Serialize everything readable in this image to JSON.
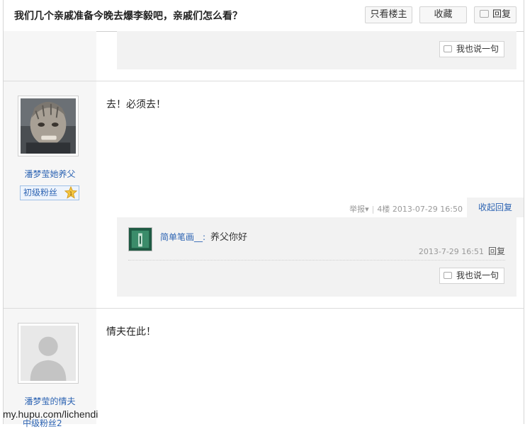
{
  "header": {
    "title": "我们几个亲戚准备今晚去爆李毅吧，亲戚们怎么看？",
    "only_lz": "只看楼主",
    "favorite": "收藏",
    "reply": "回复"
  },
  "prev_post": {
    "say_also": "我也说一句"
  },
  "post1": {
    "username": "潘梦莹她养父",
    "level": "初级粉丝",
    "level_num": "1",
    "content": "去！必须去！",
    "report": "举报▾",
    "floor": "4楼",
    "time": "2013-07-29 16:50",
    "collapse": "收起回复",
    "comment": {
      "user": "简单笔画__",
      "text": "养父你好",
      "time": "2013-7-29 16:51",
      "reply": "回复"
    },
    "say_also": "我也说一句"
  },
  "post2": {
    "username": "潘梦莹的情夫",
    "content": "情夫在此！",
    "level_partial": "中级粉丝2"
  },
  "watermark": "my.hupu.com/lichendi",
  "colors": {
    "link": "#2d64b3",
    "sidebar_bg": "#f6f6f6",
    "subbox_bg": "#f2f2f2"
  }
}
